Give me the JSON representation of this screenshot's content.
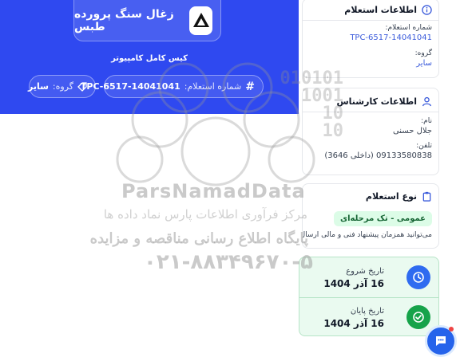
{
  "org": {
    "name": "زغال سنگ پرورده طبس",
    "subtitle": "کیس کامل کامپیوتر"
  },
  "inquiry_pills": {
    "number_label": "شماره استعلام:",
    "number_value": "TPC-6517-14041041",
    "group_label": "گروه:",
    "group_value": "سایر"
  },
  "inquiry_info": {
    "title": "اطلاعات استعلام",
    "number_label": "شماره استعلام:",
    "number_value": "TPC-6517-14041041",
    "group_label": "گروه:",
    "group_value": "سایر"
  },
  "expert_info": {
    "title": "اطلاعات کارشناس",
    "name_label": "نام:",
    "name_value": "جلال حسنی",
    "phone_label": "تلفن:",
    "phone_value": "09133580838 (داخلی 3646)"
  },
  "inquiry_type": {
    "title": "نوع استعلام",
    "badge": "عمومی - تک مرحله‌ای",
    "note": "می‌توانید همزمان پیشنهاد فنی و مالی ارسال نمایید"
  },
  "dates": {
    "start_label": "تاریخ شروع",
    "start_value": "16 آذر 1404",
    "end_label": "تاریخ پایان",
    "end_value": "16 آذر 1404"
  },
  "watermark": {
    "brand": "ParsNamadData",
    "line1": "مرکز فرآوری اطلاعات پارس نماد داده ها",
    "line2": "پایگاه اطلاع رسانی مناقصه و مزایده",
    "phone": "۰۲۱-۸۸۳۴۹۶۷۰-۵",
    "binary": [
      "010101",
      "1001",
      "10",
      "10"
    ]
  },
  "colors": {
    "hero": "#2f49f0",
    "accent": "#3b5bdb",
    "success_bg": "#eafaf0",
    "success": "#16a34a"
  },
  "icons": {
    "info": "info-icon",
    "user": "user-icon",
    "clipboard": "clipboard-icon",
    "clock": "clock-icon",
    "check": "check-circle-icon",
    "hash": "hash-icon",
    "tag": "tag-icon",
    "chat": "chat-icon"
  }
}
